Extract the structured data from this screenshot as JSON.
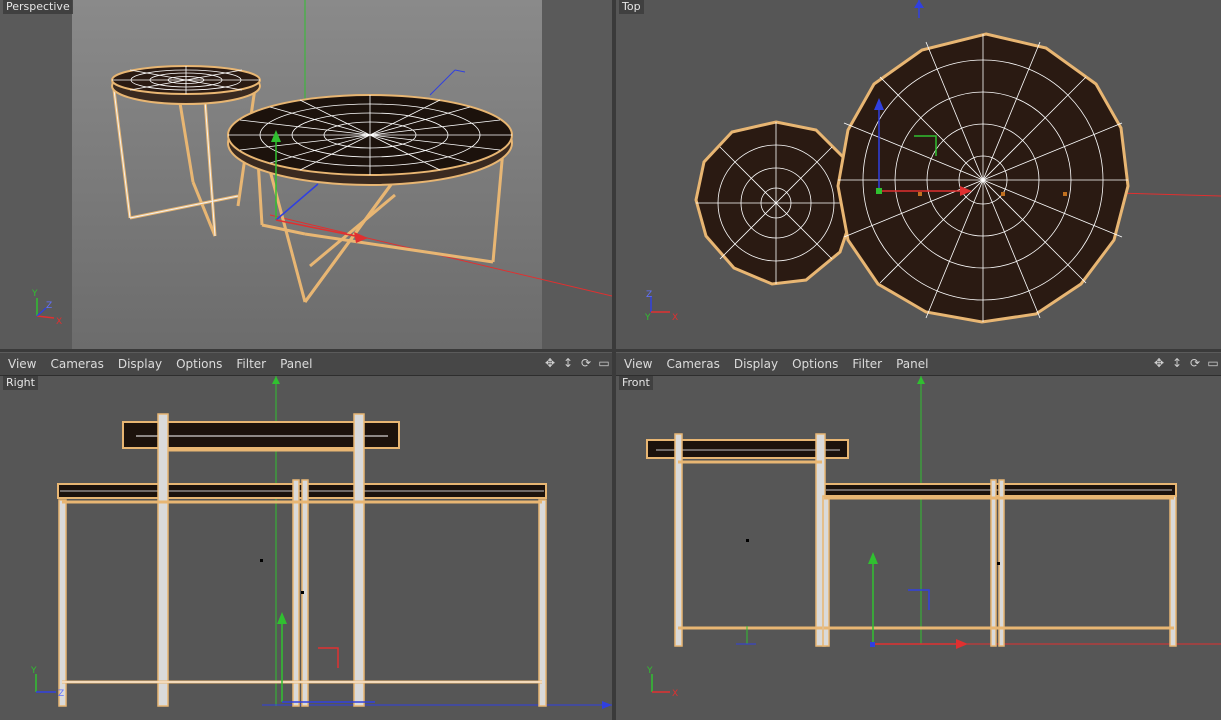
{
  "viewports": {
    "perspective": {
      "label": "Perspective"
    },
    "top": {
      "label": "Top"
    },
    "right": {
      "label": "Right"
    },
    "front": {
      "label": "Front"
    }
  },
  "menu_left": [
    "View",
    "Cameras",
    "Display",
    "Options",
    "Filter",
    "Panel"
  ],
  "menu_right": [
    "View",
    "Cameras",
    "Display",
    "Options",
    "Filter",
    "Panel"
  ],
  "axis_labels": {
    "x": "X",
    "y": "Y",
    "z": "Z"
  },
  "icons": [
    "move-view-icon",
    "scroll-view-icon",
    "rotate-view-icon",
    "maximize-view-icon"
  ],
  "colors": {
    "viewport_bg": "#565656",
    "selection_outline": "#e8b673",
    "tabletop_fill": "#2a1a12",
    "wire": "#ffffff",
    "axis_x": "#e03030",
    "axis_y": "#30c030",
    "axis_z": "#3040e0"
  }
}
